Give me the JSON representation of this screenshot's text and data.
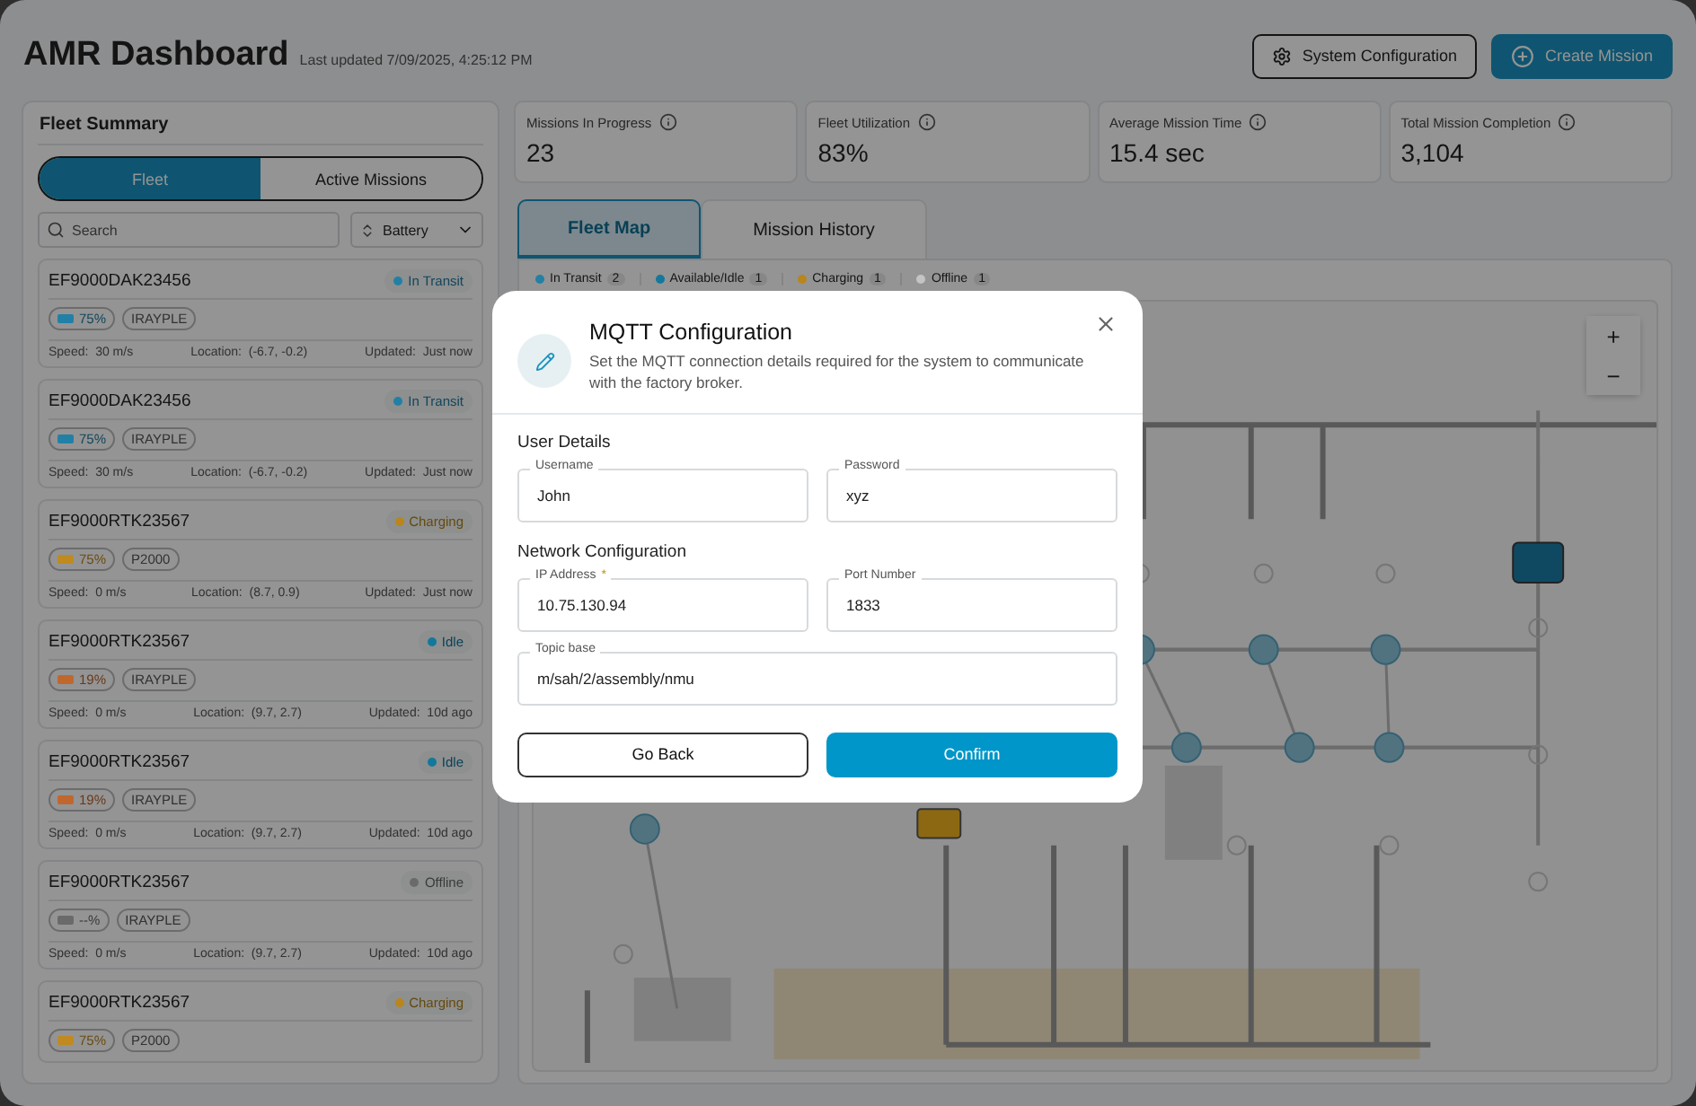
{
  "header": {
    "title": "AMR Dashboard",
    "last_updated": "Last updated 7/09/2025, 4:25:12 PM",
    "buttons": [
      {
        "kind": "outline",
        "label": "System Configuration"
      },
      {
        "kind": "primary",
        "label": "Create Mission"
      }
    ]
  },
  "fleet_summary": {
    "title": "Fleet Summary",
    "toggle": [
      {
        "label": "Fleet",
        "selected": true
      },
      {
        "label": "Active Missions",
        "selected": false
      }
    ],
    "search": {
      "placeholder": "Search"
    },
    "sort": {
      "value": "Battery"
    },
    "robots": [
      {
        "name": "EF9000DAK23456",
        "status": "In Transit",
        "color": "#2280a6",
        "battery": {
          "text": "75%",
          "color": "#2280a6"
        },
        "model": "IRAYPLE",
        "speed": "Speed:  30 m/s",
        "location": "Location:  (-6.7, -0.2)",
        "updated": "Updated:  Just now"
      },
      {
        "name": "EF9000DAK23456",
        "status": "In Transit",
        "color": "#2280a6",
        "battery": {
          "text": "75%",
          "color": "#2280a6"
        },
        "model": "IRAYPLE",
        "speed": "Speed:  30 m/s",
        "location": "Location:  (-6.7, -0.2)",
        "updated": "Updated:  Just now"
      },
      {
        "name": "EF9000RTK23567",
        "status": "Charging",
        "color": "#b8861c",
        "battery": {
          "text": "75%",
          "color": "#c08a20"
        },
        "model": "P2000",
        "speed": "Speed:  0 m/s",
        "location": "Location:  (8.7, 0.9)",
        "updated": "Updated:  Just now"
      },
      {
        "name": "EF9000RTK23567",
        "status": "Idle",
        "color": "#13789c",
        "battery": {
          "text": "19%",
          "color": "#c0672e"
        },
        "model": "IRAYPLE",
        "speed": "Speed:  0 m/s",
        "location": "Location:  (9.7, 2.7)",
        "updated": "Updated:  10d ago"
      },
      {
        "name": "EF9000RTK23567",
        "status": "Idle",
        "color": "#13789c",
        "battery": {
          "text": "19%",
          "color": "#c0672e"
        },
        "model": "IRAYPLE",
        "speed": "Speed:  0 m/s",
        "location": "Location:  (9.7, 2.7)",
        "updated": "Updated:  10d ago"
      },
      {
        "name": "EF9000RTK23567",
        "status": "Offline",
        "color": "#6a6a6a",
        "battery": {
          "text": "--%",
          "color": "#6a6a6a"
        },
        "model": "IRAYPLE",
        "speed": "Speed:  0 m/s",
        "location": "Location:  (9.7, 2.7)",
        "updated": "Updated:  10d ago"
      },
      {
        "name": "EF9000RTK23567",
        "status": "Charging",
        "color": "#b8861c",
        "battery": {
          "text": "75%",
          "color": "#c08a20"
        },
        "model": "P2000"
      }
    ]
  },
  "stats": [
    {
      "label": "Missions In Progress",
      "value": "23"
    },
    {
      "label": "Fleet Utilization",
      "value": "83%"
    },
    {
      "label": "Average Mission Time",
      "value": "15.4 sec"
    },
    {
      "label": "Total Mission Completion",
      "value": "3,104"
    }
  ],
  "tabs": [
    {
      "label": "Fleet Map",
      "selected": true
    },
    {
      "label": "Mission History",
      "selected": false
    }
  ],
  "legend": [
    {
      "label": "In Transit",
      "count": "2",
      "color": "#2280a6"
    },
    {
      "label": "Available/Idle",
      "count": "1",
      "color": "#13789c"
    },
    {
      "label": "Charging",
      "count": "1",
      "color": "#b8861c"
    },
    {
      "label": "Offline",
      "count": "1",
      "color": "#c4c4c4"
    }
  ],
  "zoom_controls": [
    "+",
    "−"
  ],
  "dialog": {
    "title": "MQTT Configuration",
    "description": "Set the MQTT connection details required for the system to communicate with the factory broker.",
    "sections": [
      {
        "title": "User Details",
        "rows": [
          [
            {
              "label": "Username",
              "value": "John"
            },
            {
              "label": "Password",
              "value": "xyz"
            }
          ]
        ]
      },
      {
        "title": "Network Configuration",
        "rows": [
          [
            {
              "label": "IP Address",
              "marker": "*",
              "value": "10.75.130.94"
            },
            {
              "label": "Port Number",
              "value": "1833"
            }
          ],
          [
            {
              "label": "Topic base",
              "value": "m/sah/2/assembly/nmu"
            }
          ]
        ]
      }
    ],
    "buttons": [
      {
        "kind": "secondary",
        "label": "Go Back"
      },
      {
        "kind": "primary",
        "label": "Confirm"
      }
    ]
  }
}
